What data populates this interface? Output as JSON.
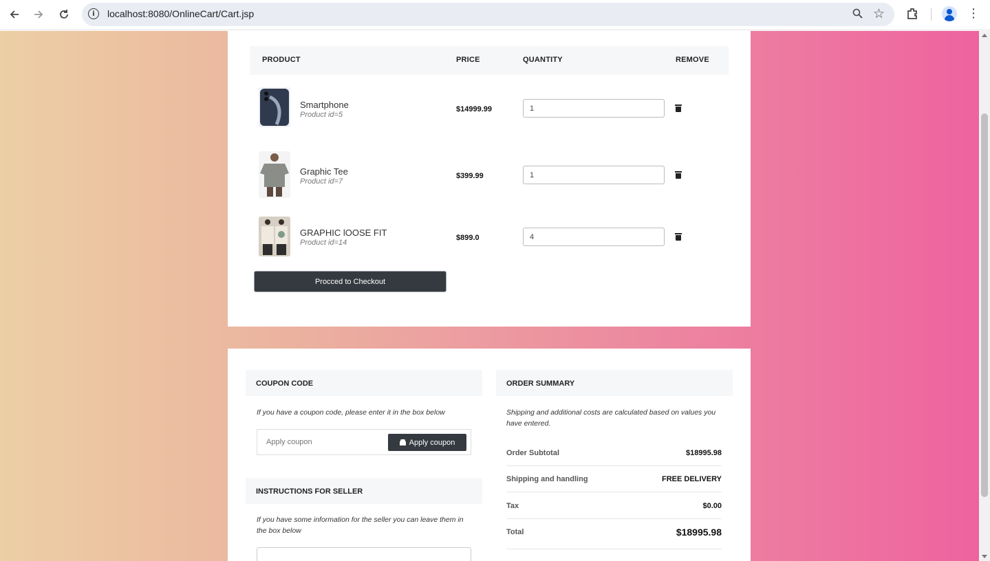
{
  "browser": {
    "url": "localhost:8080/OnlineCart/Cart.jsp"
  },
  "cart": {
    "headers": {
      "product": "PRODUCT",
      "price": "PRICE",
      "quantity": "QUANTITY",
      "remove": "REMOVE"
    },
    "items": [
      {
        "name": "Smartphone",
        "id_text": "Product id=5",
        "price": "$14999.99",
        "quantity": "1"
      },
      {
        "name": "Graphic Tee",
        "id_text": "Product id=7",
        "price": "$399.99",
        "quantity": "1"
      },
      {
        "name": "GRAPHIC lOOSE FIT",
        "id_text": "Product id=14",
        "price": "$899.0",
        "quantity": "4"
      }
    ],
    "checkout_label": "Procced to Checkout"
  },
  "coupon": {
    "title": "COUPON CODE",
    "note": "If you have a coupon code, please enter it in the box below",
    "placeholder": "Apply coupon",
    "button_label": "Apply coupon"
  },
  "instructions": {
    "title": "INSTRUCTIONS FOR SELLER",
    "note": "If you have some information for the seller you can leave them in the box below"
  },
  "summary": {
    "title": "ORDER SUMMARY",
    "note": "Shipping and additional costs are calculated based on values you have entered.",
    "rows": [
      {
        "label": "Order Subtotal",
        "value": "$18995.98"
      },
      {
        "label": "Shipping and handling",
        "value": "FREE DELIVERY"
      },
      {
        "label": "Tax",
        "value": "$0.00"
      },
      {
        "label": "Total",
        "value": "$18995.98"
      }
    ]
  },
  "icons": {
    "back": "arrow-left-icon",
    "forward": "arrow-right-icon",
    "reload": "reload-icon",
    "remove": "trash-icon",
    "coupon": "gift-icon"
  }
}
